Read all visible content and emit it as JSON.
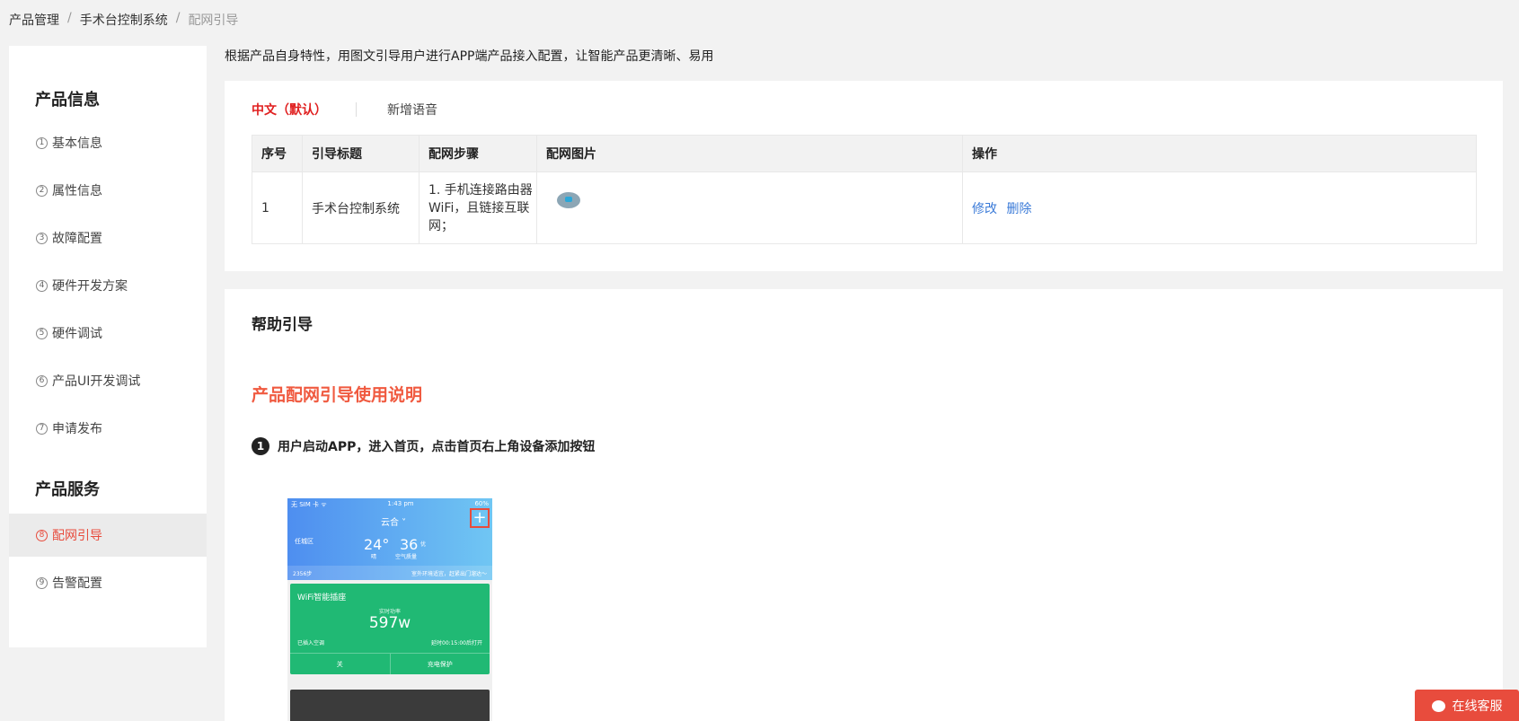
{
  "breadcrumb": {
    "items": [
      "产品管理",
      "手术台控制系统",
      "配网引导"
    ],
    "separator": "/"
  },
  "sidebar": {
    "group1_title": "产品信息",
    "group2_title": "产品服务",
    "items": [
      {
        "num": "1",
        "label": "基本信息"
      },
      {
        "num": "2",
        "label": "属性信息"
      },
      {
        "num": "3",
        "label": "故障配置"
      },
      {
        "num": "4",
        "label": "硬件开发方案"
      },
      {
        "num": "5",
        "label": "硬件调试"
      },
      {
        "num": "6",
        "label": "产品UI开发调试"
      },
      {
        "num": "7",
        "label": "申请发布"
      },
      {
        "num": "8",
        "label": "配网引导"
      },
      {
        "num": "9",
        "label": "告警配置"
      }
    ],
    "active_item": "配网引导"
  },
  "intro_text": "根据产品自身特性，用图文引导用户进行APP端产品接入配置，让智能产品更清晰、易用",
  "language_tabs": {
    "active": "中文（默认）",
    "add": "新增语音"
  },
  "table": {
    "headers": [
      "序号",
      "引导标题",
      "配网步骤",
      "配网图片",
      "操作"
    ],
    "rows": [
      {
        "index": "1",
        "title": "手术台控制系统",
        "steps": "1. 手机连接路由器WiFi，且链接互联网；",
        "edit": "修改",
        "delete": "删除"
      }
    ]
  },
  "help": {
    "title": "帮助引导",
    "heading": "产品配网引导使用说明",
    "step1_num": "1",
    "step1_text": "用户启动APP，进入首页，点击首页右上角设备添加按钮"
  },
  "phone_screenshot": {
    "carrier": "无 SIM 卡 ᯤ",
    "time": "1:43 pm",
    "battery": "60%",
    "city": "云合 ˅",
    "plus": "+",
    "location": "任城区",
    "temp": "24°",
    "temp_sub": "晴",
    "aqi": "36",
    "aqi_tag": "优",
    "aqi_sub": "空气质量",
    "steps": "2356步",
    "steps_tip": "室外环境适宜，赶紧出门溜达～",
    "device_title": "WiFi智能插座",
    "power_label": "实时功率",
    "power_value": "597w",
    "plugged": "已插入空调",
    "timer": "延时00:15:00后打开",
    "btn_off": "关",
    "btn_protect": "充电保护"
  },
  "chat_button": "在线客服",
  "colors": {
    "accent_red": "#e84c3d",
    "link_blue": "#3b7bd8",
    "heading_orange": "#f05a40",
    "tab_red": "#e02020"
  }
}
